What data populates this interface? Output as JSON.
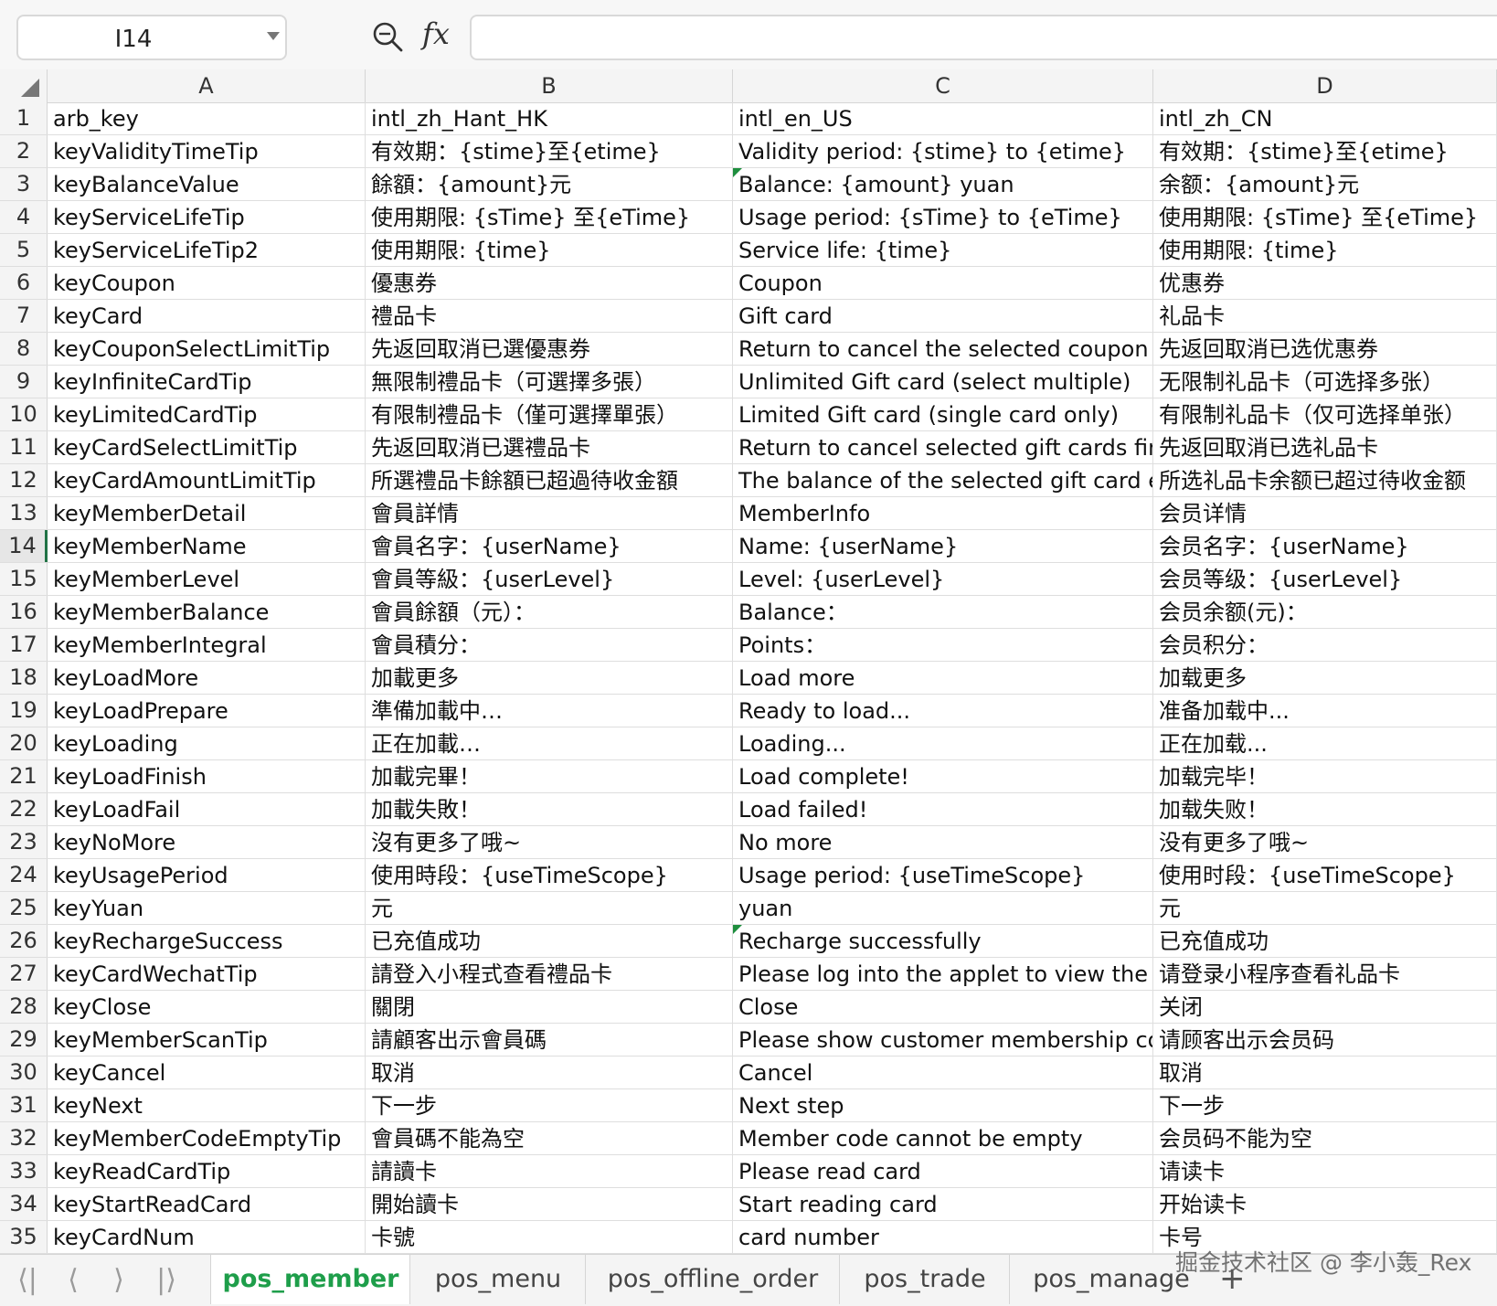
{
  "formula_bar": {
    "cell_ref": "I14",
    "fx_label": "fx",
    "formula": ""
  },
  "columns": [
    "A",
    "B",
    "C",
    "D"
  ],
  "active_row": 14,
  "rows": [
    {
      "n": "1",
      "a": "arb_key",
      "b": "intl_zh_Hant_HK",
      "c": "intl_en_US",
      "d": "intl_zh_CN"
    },
    {
      "n": "2",
      "a": "keyValidityTimeTip",
      "b": "有效期：{stime}至{etime}",
      "c": "Validity period: {stime} to {etime}",
      "d": "有效期：{stime}至{etime}"
    },
    {
      "n": "3",
      "a": "keyBalanceValue",
      "b": "餘額：{amount}元",
      "c": "Balance: {amount} yuan",
      "d": "余额：{amount}元",
      "c_mark": true
    },
    {
      "n": "4",
      "a": "keyServiceLifeTip",
      "b": "使用期限: {sTime} 至{eTime}",
      "c": "Usage period: {sTime} to {eTime}",
      "d": "使用期限: {sTime} 至{eTime}"
    },
    {
      "n": "5",
      "a": "keyServiceLifeTip2",
      "b": "使用期限: {time}",
      "c": "Service life: {time}",
      "d": "使用期限: {time}"
    },
    {
      "n": "6",
      "a": "keyCoupon",
      "b": "優惠券",
      "c": "Coupon",
      "d": "优惠券"
    },
    {
      "n": "7",
      "a": "keyCard",
      "b": "禮品卡",
      "c": "Gift card",
      "d": "礼品卡"
    },
    {
      "n": "8",
      "a": "keyCouponSelectLimitTip",
      "b": "先返回取消已選優惠券",
      "c": "Return to cancel the selected coupon first",
      "d": "先返回取消已选优惠券"
    },
    {
      "n": "9",
      "a": "keyInfiniteCardTip",
      "b": "無限制禮品卡（可選擇多張）",
      "c": "Unlimited Gift card (select multiple)",
      "d": "无限制礼品卡（可选择多张）"
    },
    {
      "n": "10",
      "a": "keyLimitedCardTip",
      "b": "有限制禮品卡（僅可選擇單張）",
      "c": "Limited Gift card (single card only)",
      "d": "有限制礼品卡（仅可选择单张）"
    },
    {
      "n": "11",
      "a": "keyCardSelectLimitTip",
      "b": "先返回取消已選禮品卡",
      "c": "Return to cancel selected gift cards first",
      "d": "先返回取消已选礼品卡"
    },
    {
      "n": "12",
      "a": "keyCardAmountLimitTip",
      "b": "所選禮品卡餘額已超過待收金額",
      "c": "The balance of the selected gift card excee",
      "d": "所选礼品卡余额已超过待收金额"
    },
    {
      "n": "13",
      "a": "keyMemberDetail",
      "b": "會員詳情",
      "c": "MemberInfo",
      "d": "会员详情"
    },
    {
      "n": "14",
      "a": "keyMemberName",
      "b": "會員名字：{userName}",
      "c": "Name: {userName}",
      "d": "会员名字：{userName}"
    },
    {
      "n": "15",
      "a": "keyMemberLevel",
      "b": "會員等級：{userLevel}",
      "c": "Level: {userLevel}",
      "d": "会员等级：{userLevel}"
    },
    {
      "n": "16",
      "a": "keyMemberBalance",
      "b": "會員餘額（元）：",
      "c": "Balance：",
      "d": "会员余额(元)："
    },
    {
      "n": "17",
      "a": "keyMemberIntegral",
      "b": "會員積分：",
      "c": "Points：",
      "d": "会员积分："
    },
    {
      "n": "18",
      "a": "keyLoadMore",
      "b": "加載更多",
      "c": "Load more",
      "d": "加载更多"
    },
    {
      "n": "19",
      "a": "keyLoadPrepare",
      "b": "準備加載中…",
      "c": "Ready to load...",
      "d": "准备加载中..."
    },
    {
      "n": "20",
      "a": "keyLoading",
      "b": "正在加載…",
      "c": "Loading...",
      "d": "正在加载..."
    },
    {
      "n": "21",
      "a": "keyLoadFinish",
      "b": "加載完畢！",
      "c": "Load complete!",
      "d": "加载完毕！"
    },
    {
      "n": "22",
      "a": "keyLoadFail",
      "b": "加載失敗！",
      "c": "Load failed!",
      "d": "加载失败！"
    },
    {
      "n": "23",
      "a": "keyNoMore",
      "b": "沒有更多了哦~",
      "c": "No more",
      "d": "没有更多了哦~"
    },
    {
      "n": "24",
      "a": "keyUsagePeriod",
      "b": "使用時段：{useTimeScope}",
      "c": "Usage period: {useTimeScope}",
      "d": "使用时段：{useTimeScope}"
    },
    {
      "n": "25",
      "a": "keyYuan",
      "b": "元",
      "c": "yuan",
      "d": "元"
    },
    {
      "n": "26",
      "a": "keyRechargeSuccess",
      "b": "已充值成功",
      "c": "Recharge successfully",
      "d": "已充值成功",
      "c_mark": true
    },
    {
      "n": "27",
      "a": "keyCardWechatTip",
      "b": "請登入小程式查看禮品卡",
      "c": "Please log into the applet to view the Gift c",
      "d": "请登录小程序查看礼品卡"
    },
    {
      "n": "28",
      "a": "keyClose",
      "b": "關閉",
      "c": "Close",
      "d": "关闭"
    },
    {
      "n": "29",
      "a": "keyMemberScanTip",
      "b": "請顧客出示會員碼",
      "c": "Please show customer membership code",
      "d": "请顾客出示会员码"
    },
    {
      "n": "30",
      "a": "keyCancel",
      "b": "取消",
      "c": "Cancel",
      "d": "取消"
    },
    {
      "n": "31",
      "a": "keyNext",
      "b": "下一步",
      "c": "Next step",
      "d": "下一步"
    },
    {
      "n": "32",
      "a": "keyMemberCodeEmptyTip",
      "b": "會員碼不能為空",
      "c": "Member code cannot be empty",
      "d": "会员码不能为空"
    },
    {
      "n": "33",
      "a": "keyReadCardTip",
      "b": "請讀卡",
      "c": "Please read card",
      "d": "请读卡"
    },
    {
      "n": "34",
      "a": "keyStartReadCard",
      "b": "開始讀卡",
      "c": "Start reading card",
      "d": "开始读卡"
    },
    {
      "n": "35",
      "a": "keyCardNum",
      "b": "卡號",
      "c": "card number",
      "d": "卡号"
    }
  ],
  "sheet_nav": {
    "first": "⟨|",
    "prev": "⟨",
    "next": "⟩",
    "last": "|⟩"
  },
  "sheets": [
    "pos_member",
    "pos_menu",
    "pos_offline_order",
    "pos_trade",
    "pos_manage"
  ],
  "active_sheet": "pos_member",
  "add_sheet": "+",
  "watermark": "掘金技术社区 @ 李小轰_Rex",
  "colors": {
    "accent": "#1e9e4a",
    "mark": "#1e8e3e",
    "header_bg": "#f4f4f4"
  }
}
